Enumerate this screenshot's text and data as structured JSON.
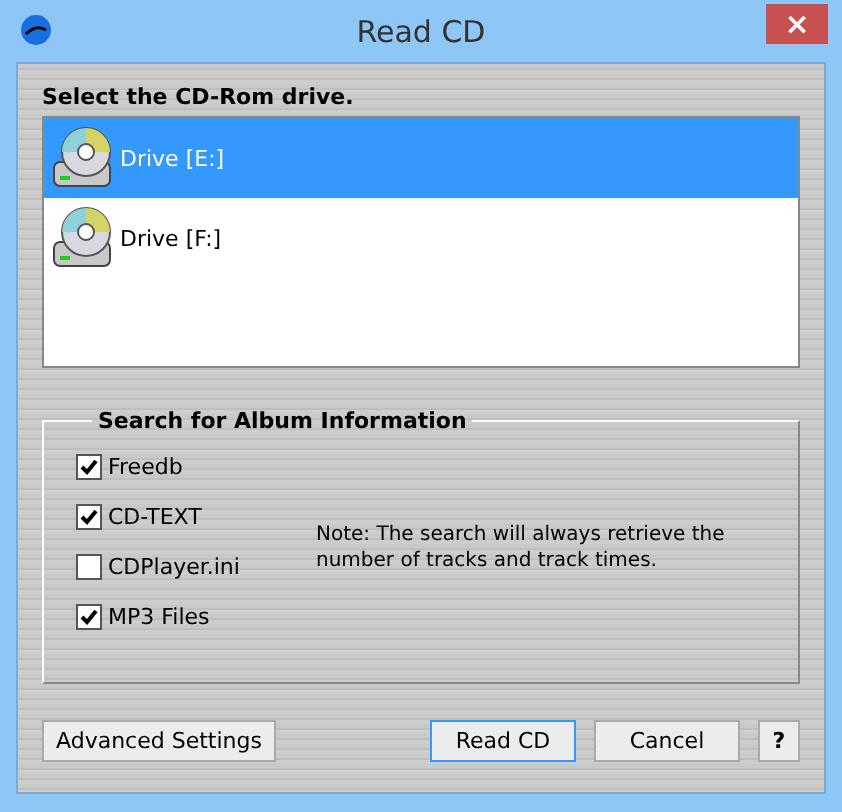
{
  "window": {
    "title": "Read CD",
    "close": "×"
  },
  "drive_list": {
    "label": "Select the CD-Rom drive.",
    "items": [
      {
        "name": "Drive [E:]",
        "selected": true
      },
      {
        "name": "Drive [F:]",
        "selected": false
      }
    ]
  },
  "search_group": {
    "title": "Search for Album Information",
    "options": [
      {
        "label": "Freedb",
        "checked": true
      },
      {
        "label": "CD-TEXT",
        "checked": true
      },
      {
        "label": "CDPlayer.ini",
        "checked": false
      },
      {
        "label": "MP3 Files",
        "checked": true
      }
    ],
    "note": "Note: The search will always retrieve the number of tracks and track times."
  },
  "buttons": [
    {
      "label": "Advanced Settings",
      "kind": "left"
    },
    {
      "label": "Read CD",
      "kind": "default"
    },
    {
      "label": "Cancel",
      "kind": "normal"
    },
    {
      "label": "?",
      "kind": "help"
    }
  ]
}
